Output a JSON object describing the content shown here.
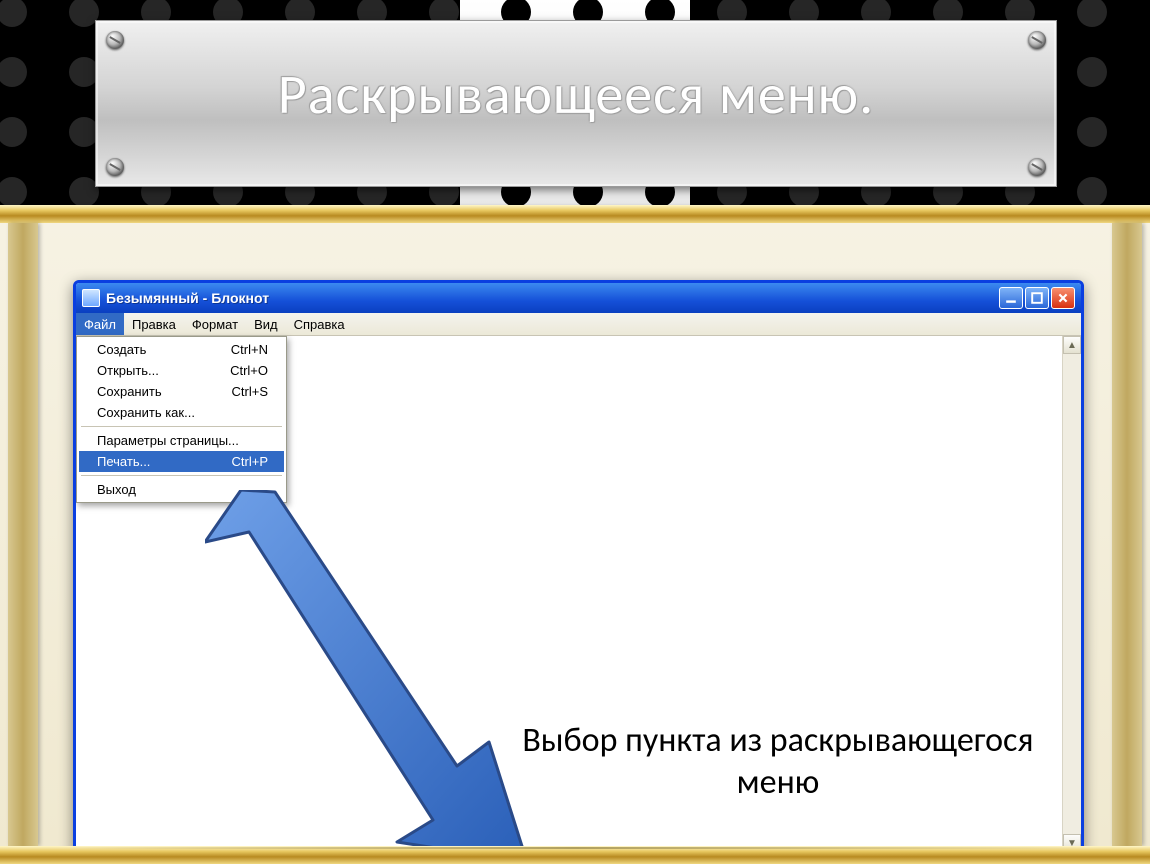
{
  "slide": {
    "title": "Раскрывающееся меню."
  },
  "notepad": {
    "title": "Безымянный - Блокнот",
    "menubar": [
      "Файл",
      "Правка",
      "Формат",
      "Вид",
      "Справка"
    ],
    "active_menu_index": 0,
    "dropdown": {
      "groups": [
        [
          {
            "label": "Создать",
            "shortcut": "Ctrl+N"
          },
          {
            "label": "Открыть...",
            "shortcut": "Ctrl+O"
          },
          {
            "label": "Сохранить",
            "shortcut": "Ctrl+S"
          },
          {
            "label": "Сохранить как...",
            "shortcut": ""
          }
        ],
        [
          {
            "label": "Параметры страницы...",
            "shortcut": ""
          },
          {
            "label": "Печать...",
            "shortcut": "Ctrl+P",
            "highlighted": true
          }
        ],
        [
          {
            "label": "Выход",
            "shortcut": ""
          }
        ]
      ]
    }
  },
  "annotation": {
    "caption": "Выбор пункта из раскрывающегося меню"
  },
  "colors": {
    "xp_blue": "#1550d8",
    "highlight": "#316ac5",
    "gold": "#c8a040"
  }
}
